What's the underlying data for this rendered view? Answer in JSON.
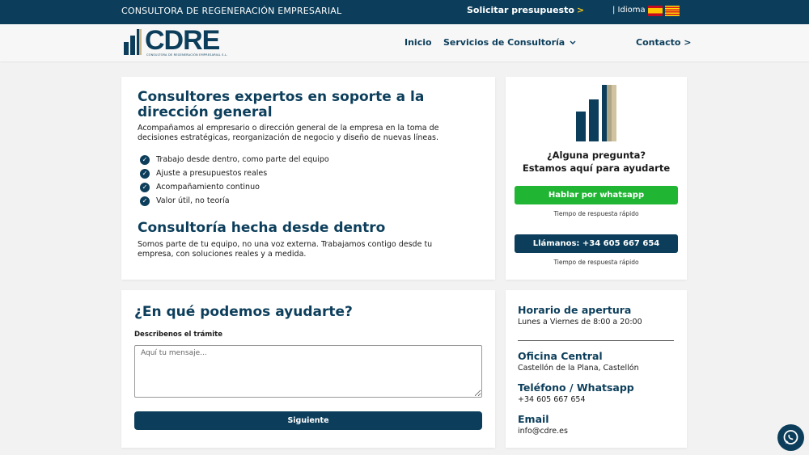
{
  "topbar": {
    "tagline": "CONSULTORA DE REGENERACIÓN EMPRESARIAL",
    "quote_label": "Solicitar presupuesto",
    "quote_arrow": ">",
    "language_label": "| Idioma"
  },
  "header": {
    "logo_text": "CDRE",
    "logo_subtitle": "CONSULTORA DE REGENERACIÓN EMPRESARIAL S.L.",
    "nav": {
      "inicio": "Inicio",
      "servicios": "Servicios de Consultoría",
      "contacto": "Contacto >"
    }
  },
  "intro": {
    "title": "Consultores expertos en soporte a la dirección general",
    "description": "Acompañamos al empresario o dirección general de la empresa en la toma de decisiones estratégicas, reorganización de negocio y diseño de nuevas líneas.",
    "checks": [
      "Trabajo desde dentro, como parte del equipo",
      "Ajuste a presupuestos reales",
      "Acompañamiento continuo",
      "Valor útil, no teoría"
    ],
    "subtitle": "Consultoría hecha desde dentro",
    "subtitle_text": "Somos parte de tu equipo, no una voz externa. Trabajamos contigo desde tu empresa, con soluciones reales y a medida."
  },
  "contact_card": {
    "question_line1": "¿Alguna pregunta?",
    "question_line2": "Estamos aquí para ayudarte",
    "whatsapp_button": "Hablar por whatsapp",
    "note_1": "Tiempo de respuesta rápido",
    "call_button": "Llámanos: +34 605 667 654",
    "note_2": "Tiempo de respuesta rápido"
  },
  "form": {
    "title": "¿En qué podemos ayudarte?",
    "label": "Describenos el trámite",
    "placeholder": "Aquí tu mensaje...",
    "submit": "Siguiente"
  },
  "info": {
    "hours_title": "Horario de apertura",
    "hours_value": "Lunes a Viernes de 8:00 a 20:00",
    "office_title": "Oficina Central",
    "office_value": "Castellón de la Plana, Castellón",
    "phone_title": "Teléfono / Whatsapp",
    "phone_value": "+34 605 667 654",
    "email_title": "Email",
    "email_value": "info@cdre.es"
  },
  "colors": {
    "brand": "#0c3e5b",
    "whatsapp": "#21b534",
    "accent": "#f5c518"
  },
  "icons": [
    "check-icon",
    "chevron-down-icon",
    "whatsapp-icon",
    "flag-spain-icon",
    "flag-catalonia-icon"
  ]
}
